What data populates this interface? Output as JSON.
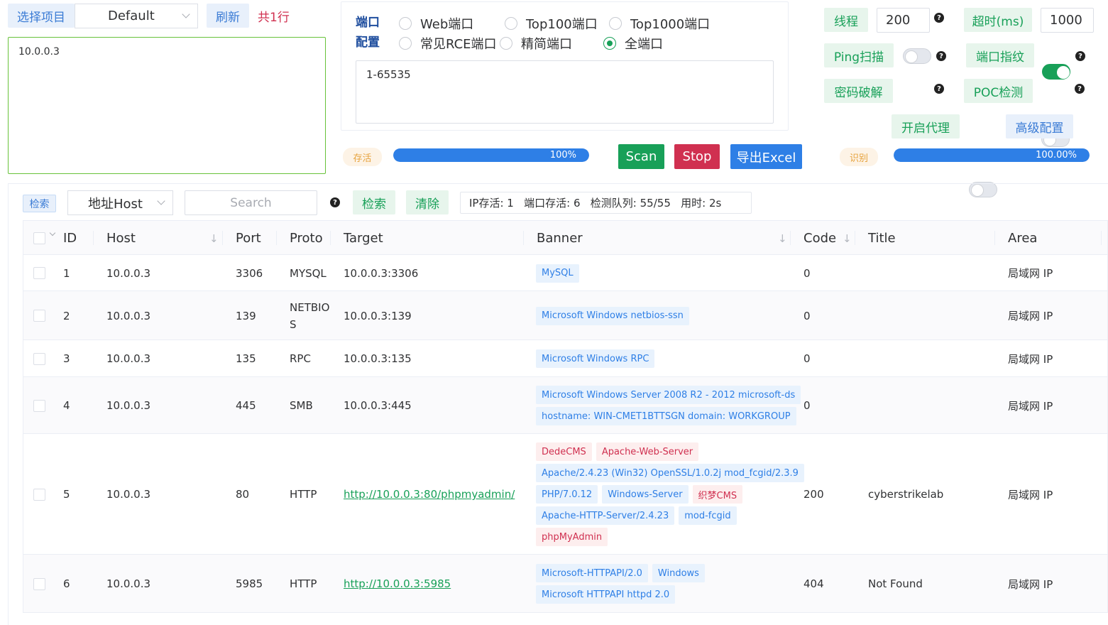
{
  "project": {
    "select_label": "选择项目",
    "selected": "Default",
    "refresh_label": "刷新",
    "count_label": "共1行",
    "targets_text": "10.0.0.3"
  },
  "port_config": {
    "label_line1": "端口",
    "label_line2": "配置",
    "options": [
      "Web端口",
      "Top100端口",
      "Top1000端口",
      "常见RCE端口",
      "精简端口",
      "全端口"
    ],
    "selected": "全端口",
    "range_text": "1-65535"
  },
  "settings": {
    "threads_label": "线程",
    "threads_value": "200",
    "timeout_label": "超时(ms)",
    "timeout_value": "1000",
    "ping_label": "Ping扫描",
    "ping_on": false,
    "fingerprint_label": "端口指纹",
    "fingerprint_on": true,
    "brute_label": "密码破解",
    "brute_on": false,
    "poc_label": "POC检测",
    "poc_on": false,
    "proxy_label": "开启代理",
    "proxy_on": false,
    "advanced_label": "高级配置",
    "help_glyph": "?"
  },
  "progress": {
    "alive_tag": "存活",
    "alive_value": 100,
    "alive_text": "100%",
    "identify_tag": "识别",
    "identify_value": 100,
    "identify_text": "100.00%"
  },
  "actions": {
    "scan_label": "Scan",
    "stop_label": "Stop",
    "export_label": "导出Excel",
    "scan_color": "#18a058",
    "stop_color": "#d03050",
    "export_color": "#2e7fe6"
  },
  "filter": {
    "tag_label": "检索",
    "field_selected": "地址Host",
    "search_placeholder": "Search",
    "search_button": "检索",
    "clear_button": "清除",
    "stats_text": "IP存活: 1   端口存活: 6   检测队列: 55/55   用时: 2s"
  },
  "table": {
    "columns": [
      "ID",
      "Host",
      "Port",
      "Proto",
      "Target",
      "Banner",
      "Code",
      "Title",
      "Area"
    ],
    "rows": [
      {
        "id": "1",
        "host": "10.0.0.3",
        "port": "3306",
        "proto": "MYSQL",
        "target": "10.0.0.3:3306",
        "target_link": false,
        "banners": [
          {
            "text": "MySQL",
            "color": "blue"
          }
        ],
        "code": "0",
        "title": "",
        "area": "局域网 IP"
      },
      {
        "id": "2",
        "host": "10.0.0.3",
        "port": "139",
        "proto": "NETBIOS",
        "target": "10.0.0.3:139",
        "target_link": false,
        "banners": [
          {
            "text": "Microsoft Windows netbios-ssn",
            "color": "blue"
          }
        ],
        "code": "0",
        "title": "",
        "area": "局域网 IP"
      },
      {
        "id": "3",
        "host": "10.0.0.3",
        "port": "135",
        "proto": "RPC",
        "target": "10.0.0.3:135",
        "target_link": false,
        "banners": [
          {
            "text": "Microsoft Windows RPC",
            "color": "blue"
          }
        ],
        "code": "0",
        "title": "",
        "area": "局域网 IP"
      },
      {
        "id": "4",
        "host": "10.0.0.3",
        "port": "445",
        "proto": "SMB",
        "target": "10.0.0.3:445",
        "target_link": false,
        "banners": [
          {
            "text": "Microsoft Windows Server 2008 R2 - 2012 microsoft-ds",
            "color": "blue"
          },
          {
            "text": "hostname: WIN-CMET1BTTSGN domain: WORKGROUP",
            "color": "blue"
          }
        ],
        "code": "0",
        "title": "",
        "area": "局域网 IP"
      },
      {
        "id": "5",
        "host": "10.0.0.3",
        "port": "80",
        "proto": "HTTP",
        "target": "http://10.0.0.3:80/phpmyadmin/",
        "target_link": true,
        "banners": [
          {
            "text": "DedeCMS",
            "color": "red"
          },
          {
            "text": "Apache-Web-Server",
            "color": "red"
          },
          {
            "text": "Apache/2.4.23 (Win32) OpenSSL/1.0.2j mod_fcgid/2.3.9",
            "color": "blue"
          },
          {
            "text": "PHP/7.0.12",
            "color": "blue"
          },
          {
            "text": "Windows-Server",
            "color": "blue"
          },
          {
            "text": "织梦CMS",
            "color": "red"
          },
          {
            "text": "Apache-HTTP-Server/2.4.23",
            "color": "blue"
          },
          {
            "text": "mod-fcgid",
            "color": "blue"
          },
          {
            "text": "phpMyAdmin",
            "color": "red"
          }
        ],
        "code": "200",
        "title": "cyberstrikelab",
        "area": "局域网 IP"
      },
      {
        "id": "6",
        "host": "10.0.0.3",
        "port": "5985",
        "proto": "HTTP",
        "target": "http://10.0.0.3:5985",
        "target_link": true,
        "banners": [
          {
            "text": "Microsoft-HTTPAPI/2.0",
            "color": "blue"
          },
          {
            "text": "Windows",
            "color": "blue"
          },
          {
            "text": "Microsoft HTTPAPI httpd 2.0",
            "color": "blue"
          }
        ],
        "code": "404",
        "title": "Not Found",
        "area": "局域网 IP"
      }
    ]
  }
}
